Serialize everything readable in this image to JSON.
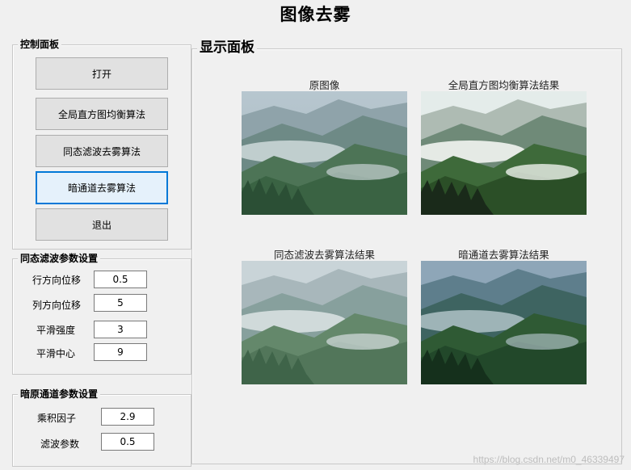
{
  "window": {
    "title": "图像去雾"
  },
  "control_panel": {
    "title": "控制面板",
    "buttons": [
      "打开",
      "全局直方图均衡算法",
      "同态滤波去雾算法",
      "暗通道去雾算法",
      "退出"
    ]
  },
  "homomorphic_params": {
    "title": "同态滤波参数设置",
    "fields": [
      {
        "label": "行方向位移",
        "value": "0.5"
      },
      {
        "label": "列方向位移",
        "value": "5"
      },
      {
        "label": "平滑强度",
        "value": "3"
      },
      {
        "label": "平滑中心",
        "value": "9"
      }
    ]
  },
  "dark_channel_params": {
    "title": "暗原通道参数设置",
    "fields": [
      {
        "label": "乘积因子",
        "value": "2.9"
      },
      {
        "label": "滤波参数",
        "value": "0.5"
      }
    ]
  },
  "display_panel": {
    "title": "显示面板",
    "images": [
      {
        "caption": "原图像"
      },
      {
        "caption": "全局直方图均衡算法结果"
      },
      {
        "caption": "同态滤波去雾算法结果"
      },
      {
        "caption": "暗通道去雾算法结果"
      }
    ]
  },
  "watermark": "https://blog.csdn.net/m0_46339497"
}
